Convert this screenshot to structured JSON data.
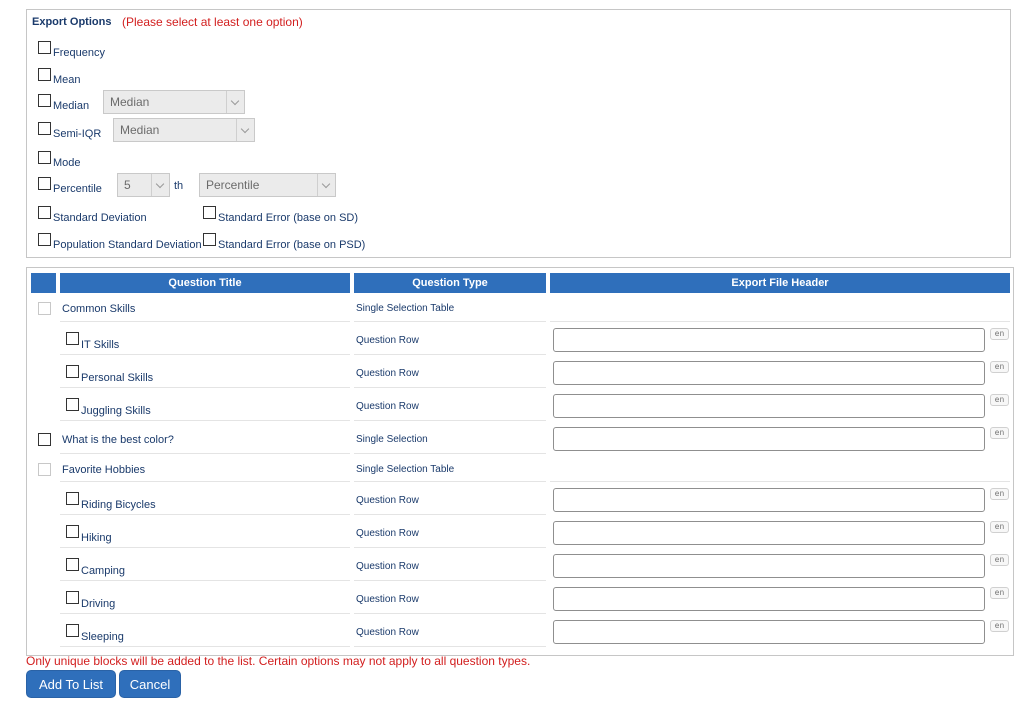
{
  "export_options": {
    "title": "Export Options",
    "warning": "(Please select at least one option)",
    "frequency": "Frequency",
    "mean": "Mean",
    "median": {
      "label": "Median",
      "select_value": "Median"
    },
    "semi_iqr": {
      "label": "Semi-IQR",
      "select_value": "Median"
    },
    "mode": "Mode",
    "percentile": {
      "label": "Percentile",
      "number_value": "5",
      "suffix": "th",
      "select_value": "Percentile"
    },
    "std_dev": "Standard Deviation",
    "std_err_sd": "Standard Error (base on SD)",
    "pop_std_dev": "Population Standard Deviation",
    "std_err_psd": "Standard Error (base on PSD)"
  },
  "table": {
    "headers": [
      "Question Title",
      "Question Type",
      "Export File Header"
    ],
    "lang_badge": "en",
    "rows": [
      {
        "title": "Common Skills",
        "type": "Single Selection Table"
      },
      {
        "title": "IT Skills",
        "type": "Question Row"
      },
      {
        "title": "Personal Skills",
        "type": "Question Row"
      },
      {
        "title": "Juggling Skills",
        "type": "Question Row"
      },
      {
        "title": "What is the best color?",
        "type": "Single Selection"
      },
      {
        "title": "Favorite Hobbies",
        "type": "Single Selection Table"
      },
      {
        "title": "Riding Bicycles",
        "type": "Question Row"
      },
      {
        "title": "Hiking",
        "type": "Question Row"
      },
      {
        "title": "Camping",
        "type": "Question Row"
      },
      {
        "title": "Driving",
        "type": "Question Row"
      },
      {
        "title": "Sleeping",
        "type": "Question Row"
      }
    ]
  },
  "note": "Only unique blocks will be added to the list. Certain options may not apply to all question types.",
  "buttons": {
    "add": "Add To List",
    "cancel": "Cancel"
  },
  "colors": {
    "accent": "#2f6fbb",
    "warning": "#d21e1e",
    "text": "#1a3a6b"
  }
}
